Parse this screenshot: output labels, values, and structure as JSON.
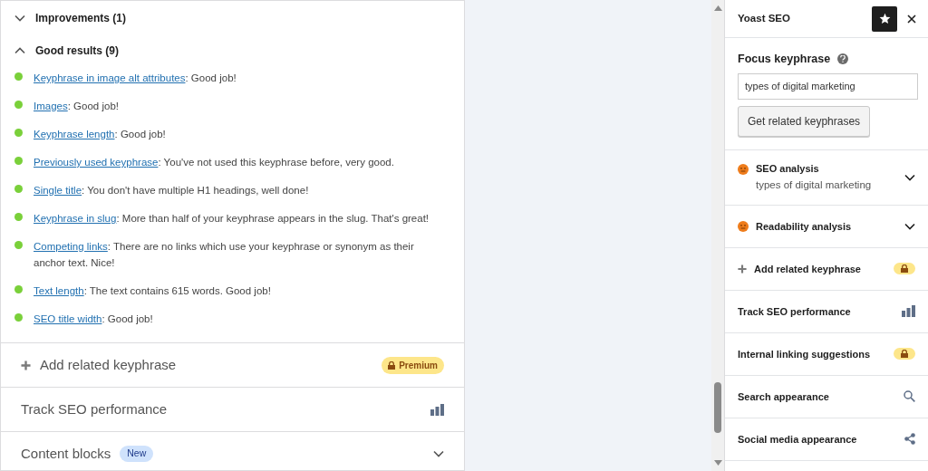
{
  "analysis_groups": [
    {
      "title": "Improvements (1)",
      "expanded": false
    },
    {
      "title": "Good results (9)",
      "expanded": true
    }
  ],
  "results": [
    {
      "link": "Keyphrase in image alt attributes",
      "text": ": Good job!"
    },
    {
      "link": "Images",
      "text": ": Good job!"
    },
    {
      "link": "Keyphrase length",
      "text": ": Good job!"
    },
    {
      "link": "Previously used keyphrase",
      "text": ": You've not used this keyphrase before, very good."
    },
    {
      "link": "Single title",
      "text": ": You don't have multiple H1 headings, well done!"
    },
    {
      "link": "Keyphrase in slug",
      "text": ": More than half of your keyphrase appears in the slug. That's great!"
    },
    {
      "link": "Competing links",
      "text": ": There are no links which use your keyphrase or synonym as their anchor text. Nice!"
    },
    {
      "link": "Text length",
      "text": ": The text contains 615 words. Good job!"
    },
    {
      "link": "SEO title width",
      "text": ": Good job!"
    }
  ],
  "main_sections": [
    {
      "kind": "premium",
      "title": "Add related keyphrase",
      "badge": "Premium"
    },
    {
      "kind": "chart",
      "title": "Track SEO performance"
    },
    {
      "kind": "new",
      "title": "Content blocks",
      "badge": "New"
    }
  ],
  "sidebar": {
    "title": "Yoast SEO",
    "focus_label": "Focus keyphrase",
    "focus_value": "types of digital marketing",
    "related_button": "Get related keyphrases",
    "items": [
      {
        "kind": "analysis",
        "title": "SEO analysis",
        "subtitle": "types of digital marketing",
        "color": "#ee7c1b"
      },
      {
        "kind": "analysis",
        "title": "Readability analysis",
        "color": "#ee7c1b"
      },
      {
        "kind": "premium",
        "title": "Add related keyphrase"
      },
      {
        "kind": "chart",
        "title": "Track SEO performance"
      },
      {
        "kind": "locked",
        "title": "Internal linking suggestions"
      },
      {
        "kind": "search",
        "title": "Search appearance"
      },
      {
        "kind": "share",
        "title": "Social media appearance"
      }
    ]
  }
}
